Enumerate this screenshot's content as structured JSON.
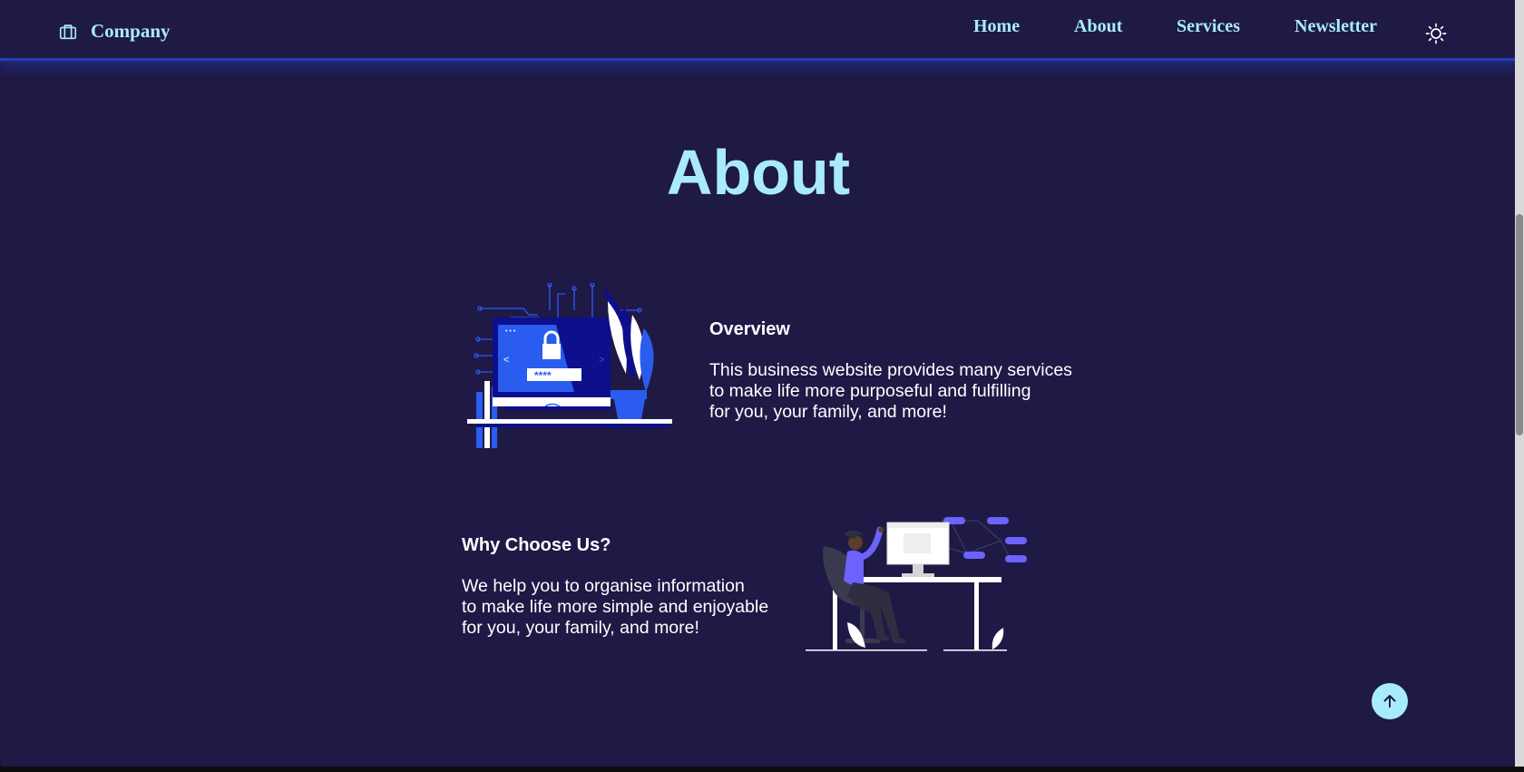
{
  "brand": {
    "name": "Company",
    "icon": "briefcase-icon"
  },
  "nav": {
    "items": [
      {
        "label": "Home"
      },
      {
        "label": "About"
      },
      {
        "label": "Services"
      },
      {
        "label": "Newsletter"
      }
    ],
    "theme_toggle_icon": "sun-icon"
  },
  "main": {
    "title": "About",
    "overview": {
      "heading": "Overview",
      "lines": [
        "This business website provides many services",
        "to make life more purposeful and fulfilling",
        "for you, your family, and more!"
      ],
      "illustration_icon": "secure-login-illustration"
    },
    "why": {
      "heading": "Why Choose Us?",
      "lines": [
        "We help you to organise information",
        "to make life more simple and enjoyable",
        "for you, your family, and more!"
      ],
      "illustration_icon": "person-at-desk-illustration"
    }
  },
  "scroll_top_icon": "arrow-up-icon",
  "colors": {
    "background": "#1f1946",
    "accent": "#a8ecfb",
    "nav_glow": "#2540b8",
    "illustration_blue": "#2a5cf0",
    "illustration_purple": "#6c63ff"
  },
  "pixel_fixture": {
    "asterisks": "****",
    "chevron_left": "<",
    "chevron_right": ">",
    "window_dots": "• • •"
  }
}
